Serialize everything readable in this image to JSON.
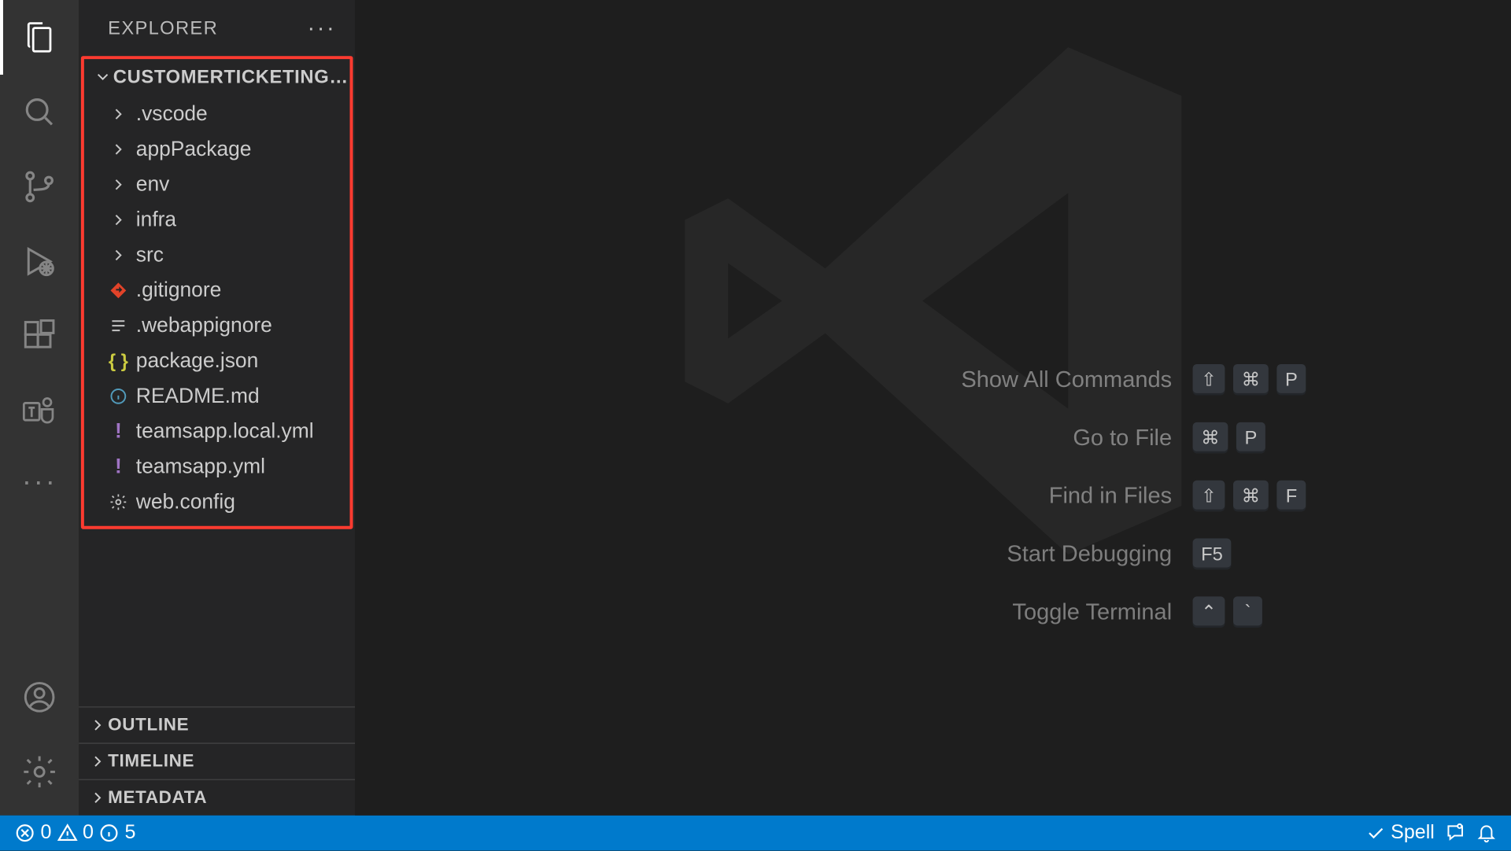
{
  "sidebar": {
    "title": "EXPLORER",
    "project_name": "CUSTOMERTICKETINGT…",
    "sections": {
      "outline": "OUTLINE",
      "timeline": "TIMELINE",
      "metadata": "METADATA"
    }
  },
  "tree": {
    "folders": [
      {
        "name": ".vscode"
      },
      {
        "name": "appPackage"
      },
      {
        "name": "env"
      },
      {
        "name": "infra"
      },
      {
        "name": "src"
      }
    ],
    "files": [
      {
        "name": ".gitignore",
        "icon": "git"
      },
      {
        "name": ".webappignore",
        "icon": "lines"
      },
      {
        "name": "package.json",
        "icon": "json"
      },
      {
        "name": "README.md",
        "icon": "info"
      },
      {
        "name": "teamsapp.local.yml",
        "icon": "bang"
      },
      {
        "name": "teamsapp.yml",
        "icon": "bang"
      },
      {
        "name": "web.config",
        "icon": "gear"
      }
    ]
  },
  "shortcuts": [
    {
      "label": "Show All Commands",
      "keys": [
        "⇧",
        "⌘",
        "P"
      ]
    },
    {
      "label": "Go to File",
      "keys": [
        "⌘",
        "P"
      ]
    },
    {
      "label": "Find in Files",
      "keys": [
        "⇧",
        "⌘",
        "F"
      ]
    },
    {
      "label": "Start Debugging",
      "keys": [
        "F5"
      ]
    },
    {
      "label": "Toggle Terminal",
      "keys": [
        "⌃",
        "`"
      ]
    }
  ],
  "status": {
    "errors": "0",
    "warnings": "0",
    "info": "5",
    "spell": "Spell"
  }
}
